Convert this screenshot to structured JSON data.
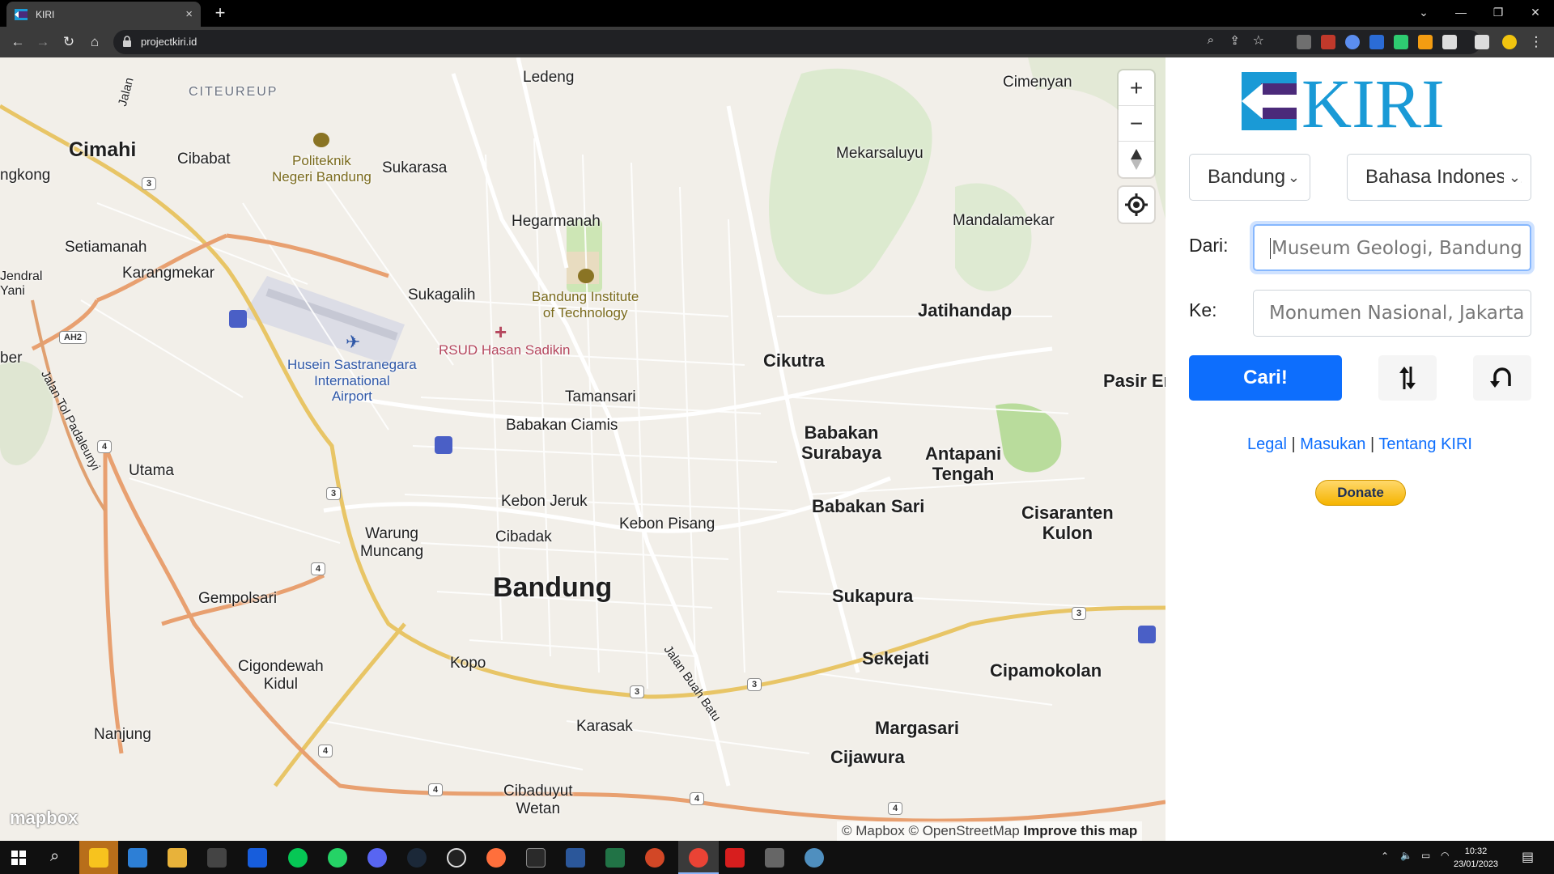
{
  "browser": {
    "tab_title": "KIRI",
    "tab_close": "×",
    "new_tab": "+",
    "url": "projectkiri.id"
  },
  "map": {
    "places": {
      "cimahi": "Cimahi",
      "citeureup": "CITEUREUP",
      "cibabat": "Cibabat",
      "ngkong": "ngkong",
      "setiamanah": "Setiamanah",
      "karangmekar": "Karangmekar",
      "jendral_yani": "Jendral\nYani",
      "ber": "ber",
      "jalan": "Jalan",
      "jalan_tol": "Jalan Tol Padaleunyi",
      "utama": "Utama",
      "politeknik": "Politeknik\nNegeri Bandung",
      "sukarasa": "Sukarasa",
      "ledeng": "Ledeng",
      "hegarmanah": "Hegarmanah",
      "sukagalih": "Sukagalih",
      "itb": "Bandung Institute\nof Technology",
      "rsud": "RSUD Hasan Sadikin",
      "airport": "Husein Sastranegara\nInternational\nAirport",
      "tamansari": "Tamansari",
      "babakan_ciamis": "Babakan Ciamis",
      "kebon_jeruk": "Kebon Jeruk",
      "cibadak": "Cibadak",
      "kebon_pisang": "Kebon Pisang",
      "warung_muncang": "Warung\nMuncang",
      "bandung": "Bandung",
      "gempolsari": "Gempolsari",
      "jalan_buah_batu": "Jalan Buah Batu",
      "kopo": "Kopo",
      "cigondewah": "Cigondewah\nKidul",
      "nanjung": "Nanjung",
      "karasak": "Karasak",
      "cibaduyut": "Cibaduyut\nWetan",
      "cimenyan": "Cimenyan",
      "mekarsaluyu": "Mekarsaluyu",
      "mandalamekar": "Mandalamekar",
      "jatihandap": "Jatihandap",
      "cikutra": "Cikutra",
      "pasir": "Pasir Er",
      "babakan_surabaya": "Babakan\nSurabaya",
      "antapani": "Antapani\nTengah",
      "babakan_sari": "Babakan Sari",
      "cisaranten": "Cisaranten\nKulon",
      "sukapura": "Sukapura",
      "sekejati": "Sekejati",
      "cipamokolan": "Cipamokolan",
      "margasari": "Margasari",
      "cijawura": "Cijawura"
    },
    "shields": {
      "three": "3",
      "four": "4",
      "ah2": "AH2"
    },
    "zoom_in": "+",
    "zoom_out": "−",
    "logo": "mapbox",
    "attribution_a": "© Mapbox © OpenStreetMap",
    "attribution_b": "Improve this map"
  },
  "panel": {
    "city_select": "Bandung",
    "language_select": "Bahasa Indonesia",
    "from_label": "Dari:",
    "from_placeholder": "Museum Geologi, Bandung",
    "to_label": "Ke:",
    "to_placeholder": "Monumen Nasional, Jakarta",
    "search_button": "Cari!",
    "links": {
      "legal": "Legal",
      "sep1": " | ",
      "feedback": "Masukan",
      "sep2": " | ",
      "about": "Tentang KIRI"
    },
    "donate": "Donate",
    "logo_text": "KIRI",
    "colors": {
      "brand_blue": "#1a9ad6",
      "brand_purple": "#4b2a7a",
      "primary": "#0d6efd"
    }
  },
  "taskbar": {
    "time": "10:32",
    "date": "23/01/2023"
  }
}
